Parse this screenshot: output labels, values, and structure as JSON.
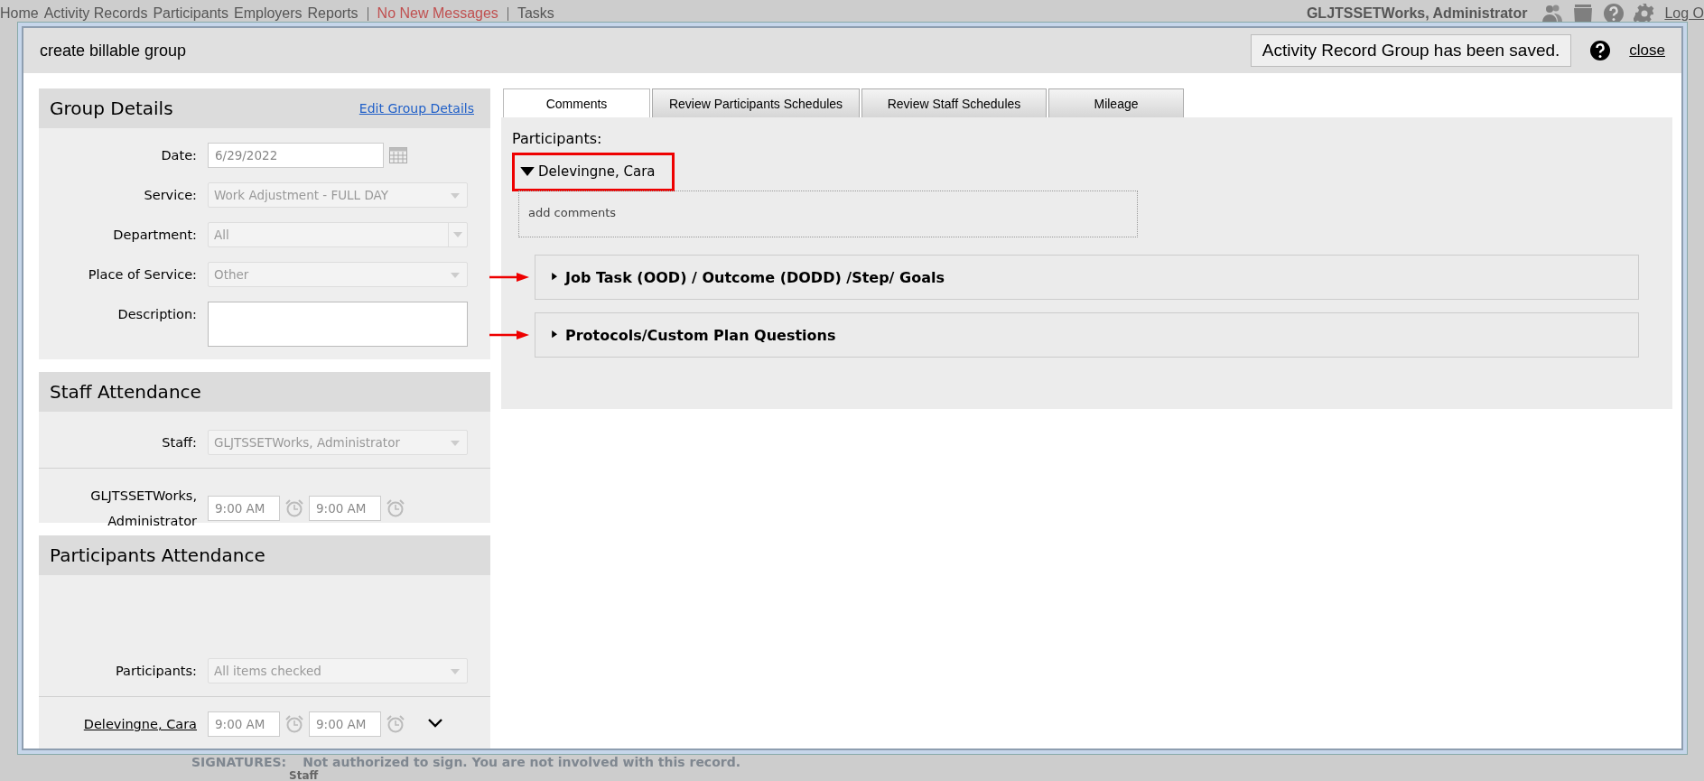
{
  "nav": {
    "links": [
      "Home",
      "Activity Records",
      "Participants",
      "Employers",
      "Reports"
    ],
    "messages": "No New Messages",
    "tasks": "Tasks",
    "user": "GLJTSSETWorks, Administrator",
    "logout": "Log O"
  },
  "background": {
    "signatures_label": "SIGNATURES:",
    "signatures_text": "Not authorized to sign. You are not involved with this record.",
    "column_label": "Staff"
  },
  "dialog": {
    "title": "create billable group",
    "notice": "Activity Record Group has been saved.",
    "close": "close",
    "group_details": {
      "heading": "Group Details",
      "edit_link": "Edit Group Details",
      "fields": [
        {
          "kind": "date",
          "label": "Date:",
          "value": "6/29/2022"
        },
        {
          "kind": "select",
          "label": "Service:",
          "value": "Work Adjustment - FULL DAY"
        },
        {
          "kind": "combo",
          "label": "Department:",
          "value": "All"
        },
        {
          "kind": "select",
          "label": "Place of Service:",
          "value": "Other"
        },
        {
          "kind": "textarea",
          "label": "Description:"
        }
      ]
    },
    "staff_attendance": {
      "heading": "Staff Attendance",
      "staff_field": {
        "label": "Staff:",
        "value": "GLJTSSETWorks, Administrator"
      },
      "rows": [
        {
          "name": "GLJTSSETWorks, Administrator",
          "start": "9:00 AM",
          "end": "9:00 AM"
        }
      ]
    },
    "participants_attendance": {
      "heading": "Participants Attendance",
      "participants_field": {
        "label": "Participants:",
        "value": "All items checked"
      },
      "rows": [
        {
          "name": "Delevingne, Cara",
          "start": "9:00 AM",
          "end": "9:00 AM",
          "expanded": false
        }
      ]
    },
    "tabs": [
      {
        "label": "Comments",
        "selected": true
      },
      {
        "label": "Review Participants Schedules",
        "selected": false
      },
      {
        "label": "Review Staff Schedules",
        "selected": false
      },
      {
        "label": "Mileage",
        "selected": false
      }
    ],
    "comments": {
      "label": "Participants:",
      "participants": [
        {
          "name": "Delevingne, Cara",
          "expanded": true,
          "highlighted": true,
          "placeholder": "add comments",
          "sections": [
            {
              "title": "Job Task (OOD) / Outcome (DODD) /Step/ Goals",
              "expanded": false,
              "annotated": true
            },
            {
              "title": "Protocols/Custom Plan Questions",
              "expanded": false,
              "annotated": true
            }
          ]
        }
      ]
    }
  }
}
